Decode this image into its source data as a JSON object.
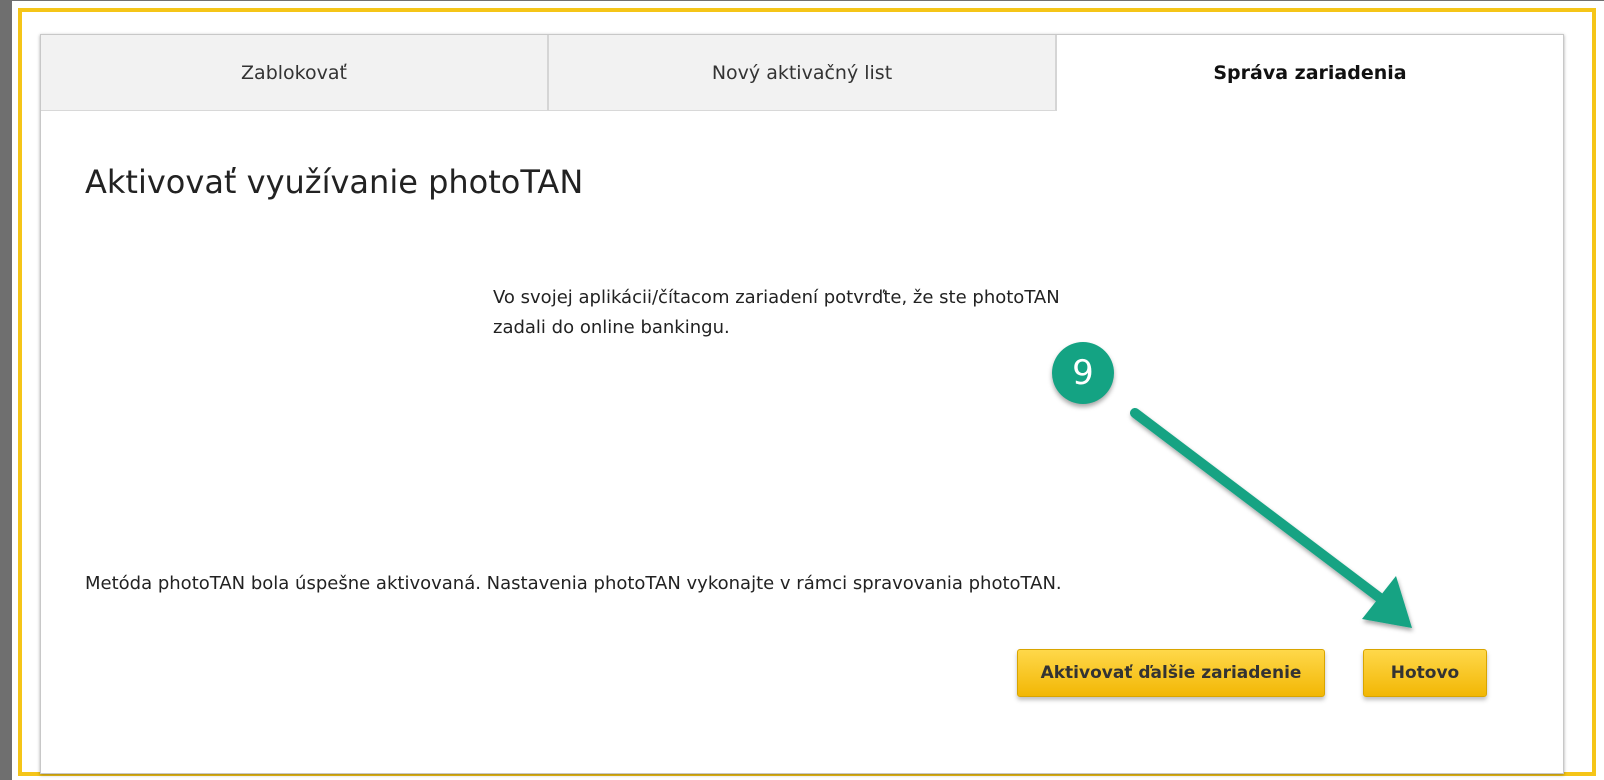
{
  "tabs": [
    {
      "label": "Zablokovať",
      "active": false
    },
    {
      "label": "Nový aktivačný list",
      "active": false
    },
    {
      "label": "Správa zariadenia",
      "active": true
    }
  ],
  "main": {
    "title": "Aktivovať využívanie photoTAN",
    "instruction_line1": "Vo svojej aplikácii/čítacom zariadení potvrďte, že ste photoTAN",
    "instruction_line2": "zadali do online bankingu.",
    "success_message": "Metóda photoTAN bola úspešne aktivovaná. Nastavenia photoTAN vykonajte v rámci spravovania photoTAN."
  },
  "buttons": {
    "activate_another_label": "Aktivovať ďalšie zariadenie",
    "done_label": "Hotovo"
  },
  "annotation": {
    "step_number": "9",
    "badge_color": "#14a383",
    "arrow_color": "#14a383"
  },
  "colors": {
    "accent_yellow": "#f5c518",
    "button_yellow": "#f7c21b"
  }
}
